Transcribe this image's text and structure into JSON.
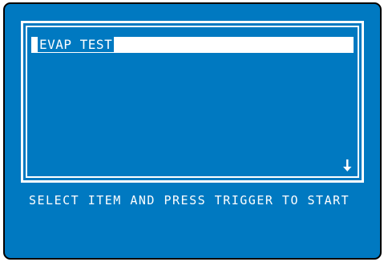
{
  "menu": {
    "items": [
      {
        "label": "EVAP TEST",
        "selected": true
      }
    ],
    "scroll_indicator": "down-arrow-icon"
  },
  "footer": {
    "prompt": "SELECT ITEM AND PRESS TRIGGER TO START"
  },
  "colors": {
    "screen_background": "#0079c1",
    "foreground": "#ffffff",
    "bezel": "#000000"
  }
}
